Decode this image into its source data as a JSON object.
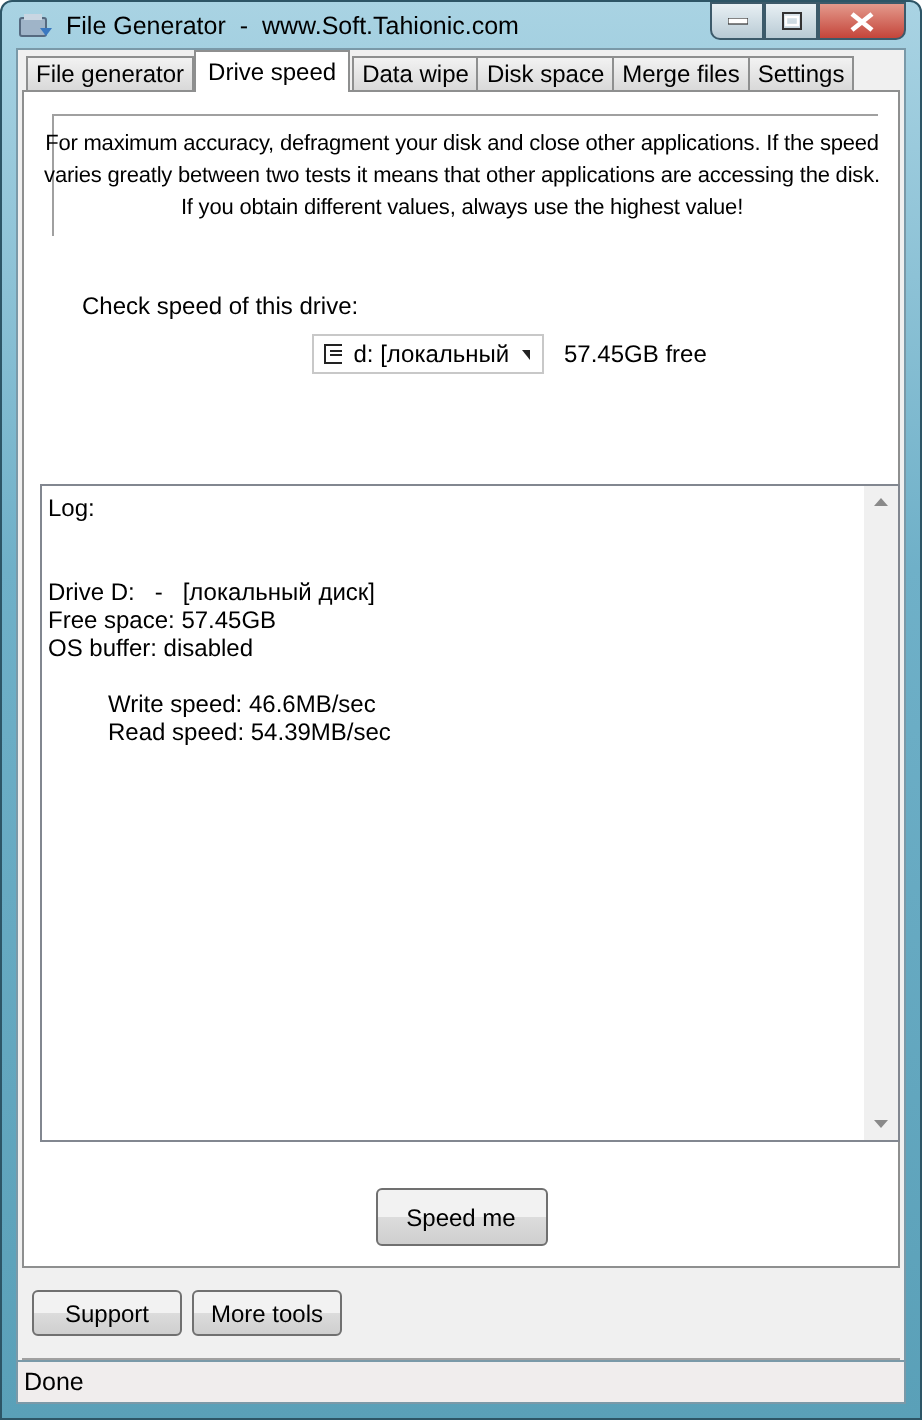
{
  "window": {
    "title": "File Generator  -  www.Soft.Tahionic.com"
  },
  "tabs": [
    {
      "label": "File generator",
      "selected": false
    },
    {
      "label": "Drive speed",
      "selected": true
    },
    {
      "label": "Data wipe",
      "selected": false
    },
    {
      "label": "Disk space",
      "selected": false
    },
    {
      "label": "Merge files",
      "selected": false
    },
    {
      "label": "Settings",
      "selected": false
    }
  ],
  "notice": "For maximum accuracy, defragment your disk and close other applications. If the speed varies greatly between two tests it means that other applications are accessing the disk. If you obtain different values, always use the highest value!",
  "drive": {
    "label": "Check speed of this drive:",
    "value": "d: [локальный",
    "free": "57.45GB free"
  },
  "log": {
    "sections": [
      {
        "indented": false,
        "lines": [
          "Log:"
        ]
      },
      {
        "indented": false,
        "lines": [
          "Drive D:   -   [локальный диск]",
          "Free space: 57.45GB",
          "OS buffer: disabled"
        ]
      },
      {
        "indented": true,
        "lines": [
          "Write speed: 46.6MB/sec",
          "Read speed: 54.39MB/sec"
        ]
      }
    ]
  },
  "run_button": "Speed me",
  "footer_buttons": [
    "Support",
    "More tools"
  ],
  "status_bar": "Done"
}
